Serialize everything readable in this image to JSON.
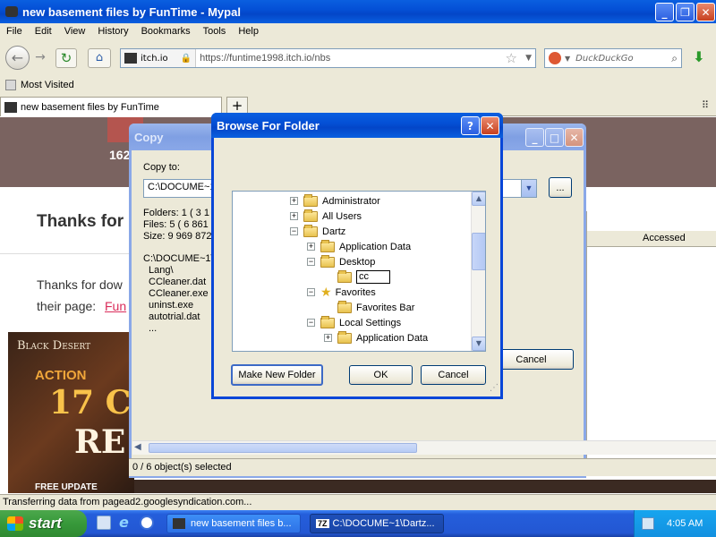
{
  "browser": {
    "title": "new basement files by FunTime - Mypal",
    "menu": [
      "File",
      "Edit",
      "View",
      "History",
      "Bookmarks",
      "Tools",
      "Help"
    ],
    "site_badge": "itch.io",
    "url": "https://funtime1998.itch.io/nbs",
    "search_placeholder": "DuckDuckGo",
    "bookmark": "Most Visited",
    "tab": "new basement files by FunTime",
    "tab_plus": "+"
  },
  "page": {
    "number": "162",
    "heading": "Thanks for",
    "body1": "Thanks for dow",
    "body2": "their page:",
    "link": "Fun",
    "ad_title": "Black Desert",
    "ad_action": "ACTION",
    "ad_big": "17 C",
    "ad_re": "RE",
    "ad_bottom": "FREE UPDATE"
  },
  "status": "Transferring data from pagead2.googlesyndication.com...",
  "copy_dialog": {
    "title": "Copy",
    "copy_to_label": "Copy to:",
    "path": "C:\\DOCUME~1",
    "browse_button": "...",
    "folders": "Folders: 1    ( 3 1",
    "files": "Files: 5    ( 6 861",
    "size": "Size: 9 969 872",
    "list_header": "C:\\DOCUME~1\\",
    "items": [
      "Lang\\",
      "CCleaner.dat",
      "CCleaner.exe",
      "uninst.exe",
      "autotrial.dat",
      "..."
    ],
    "cancel": "Cancel",
    "accessed_col": "Accessed",
    "status": "0 / 6 object(s) selected",
    "taskbar_label": "C:\\DOCUME~1\\Dartz..."
  },
  "browse": {
    "title": "Browse For Folder",
    "help": "?",
    "close": "✕",
    "tree": [
      {
        "label": "Administrator",
        "indent": 0,
        "exp": "+"
      },
      {
        "label": "All Users",
        "indent": 0,
        "exp": "+"
      },
      {
        "label": "Dartz",
        "indent": 0,
        "exp": "−"
      },
      {
        "label": "Application Data",
        "indent": 1,
        "exp": "+"
      },
      {
        "label": "Desktop",
        "indent": 1,
        "exp": "−"
      },
      {
        "label": "cc",
        "indent": 2,
        "exp": ""
      },
      {
        "label": "Favorites",
        "indent": 1,
        "exp": "−"
      },
      {
        "label": "Favorites Bar",
        "indent": 2,
        "exp": ""
      },
      {
        "label": "Local Settings",
        "indent": 1,
        "exp": "−"
      },
      {
        "label": "Application Data",
        "indent": 2,
        "exp": "+"
      }
    ],
    "new_folder": "Make New Folder",
    "ok": "OK",
    "cancel": "Cancel"
  },
  "taskbar": {
    "start": "start",
    "task1": "new basement files b...",
    "task2_prefix": "7Z",
    "task2": "C:\\DOCUME~1\\Dartz...",
    "clock": "4:05 AM"
  }
}
